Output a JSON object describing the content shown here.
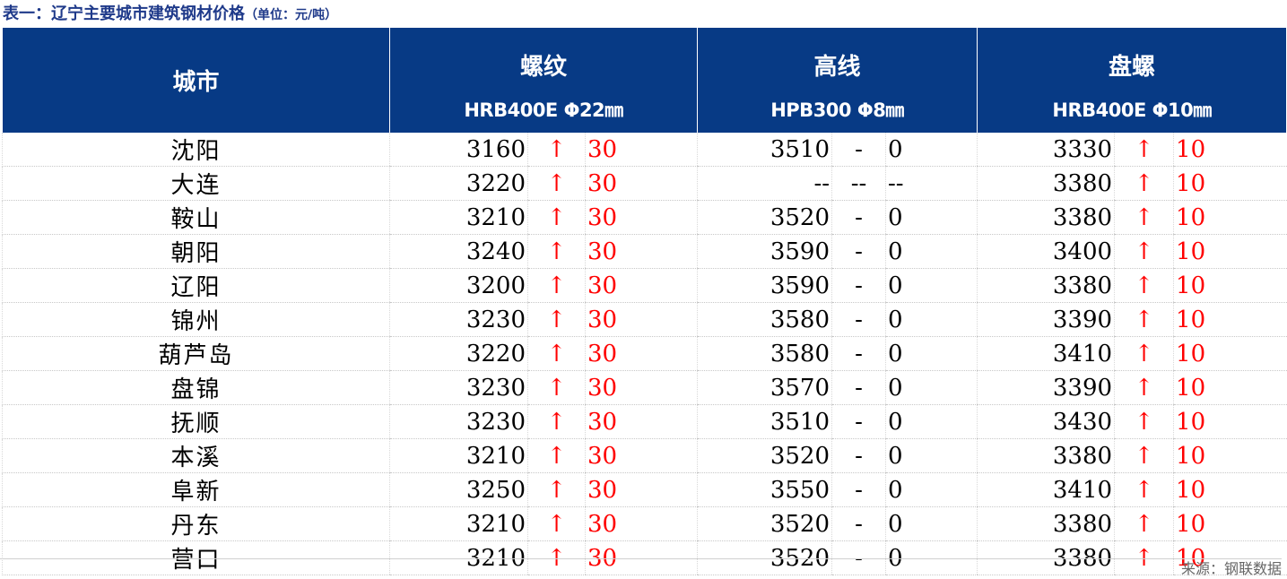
{
  "title": "表一：辽宁主要城市建筑钢材价格",
  "unit": "（单位：元/吨）",
  "header": {
    "city": "城市",
    "products": [
      {
        "name": "螺纹",
        "spec": "HRB400E Φ22㎜"
      },
      {
        "name": "高线",
        "spec": "HPB300 Φ8㎜"
      },
      {
        "name": "盘螺",
        "spec": "HRB400E Φ10㎜"
      }
    ]
  },
  "rows": [
    {
      "city": "沈阳",
      "c": [
        [
          "3160",
          "↑",
          "30"
        ],
        [
          "3510",
          "-",
          "0"
        ],
        [
          "3330",
          "↑",
          "10"
        ]
      ]
    },
    {
      "city": "大连",
      "c": [
        [
          "3220",
          "↑",
          "30"
        ],
        [
          "--",
          "--",
          "--"
        ],
        [
          "3380",
          "↑",
          "10"
        ]
      ]
    },
    {
      "city": "鞍山",
      "c": [
        [
          "3210",
          "↑",
          "30"
        ],
        [
          "3520",
          "-",
          "0"
        ],
        [
          "3380",
          "↑",
          "10"
        ]
      ]
    },
    {
      "city": "朝阳",
      "c": [
        [
          "3240",
          "↑",
          "30"
        ],
        [
          "3590",
          "-",
          "0"
        ],
        [
          "3400",
          "↑",
          "10"
        ]
      ]
    },
    {
      "city": "辽阳",
      "c": [
        [
          "3200",
          "↑",
          "30"
        ],
        [
          "3590",
          "-",
          "0"
        ],
        [
          "3380",
          "↑",
          "10"
        ]
      ]
    },
    {
      "city": "锦州",
      "c": [
        [
          "3230",
          "↑",
          "30"
        ],
        [
          "3580",
          "-",
          "0"
        ],
        [
          "3390",
          "↑",
          "10"
        ]
      ]
    },
    {
      "city": "葫芦岛",
      "c": [
        [
          "3220",
          "↑",
          "30"
        ],
        [
          "3580",
          "-",
          "0"
        ],
        [
          "3410",
          "↑",
          "10"
        ]
      ]
    },
    {
      "city": "盘锦",
      "c": [
        [
          "3230",
          "↑",
          "30"
        ],
        [
          "3570",
          "-",
          "0"
        ],
        [
          "3390",
          "↑",
          "10"
        ]
      ]
    },
    {
      "city": "抚顺",
      "c": [
        [
          "3230",
          "↑",
          "30"
        ],
        [
          "3510",
          "-",
          "0"
        ],
        [
          "3430",
          "↑",
          "10"
        ]
      ]
    },
    {
      "city": "本溪",
      "c": [
        [
          "3210",
          "↑",
          "30"
        ],
        [
          "3520",
          "-",
          "0"
        ],
        [
          "3380",
          "↑",
          "10"
        ]
      ]
    },
    {
      "city": "阜新",
      "c": [
        [
          "3250",
          "↑",
          "30"
        ],
        [
          "3550",
          "-",
          "0"
        ],
        [
          "3410",
          "↑",
          "10"
        ]
      ]
    },
    {
      "city": "丹东",
      "c": [
        [
          "3210",
          "↑",
          "30"
        ],
        [
          "3520",
          "-",
          "0"
        ],
        [
          "3380",
          "↑",
          "10"
        ]
      ]
    },
    {
      "city": "营口",
      "c": [
        [
          "3210",
          "↑",
          "30"
        ],
        [
          "3520",
          "-",
          "0"
        ],
        [
          "3380",
          "↑",
          "10"
        ]
      ]
    }
  ],
  "source": "来源：钢联数据",
  "colors": {
    "header_bg": "#073a85",
    "title": "#1f3a8a",
    "up": "#ff0000"
  }
}
